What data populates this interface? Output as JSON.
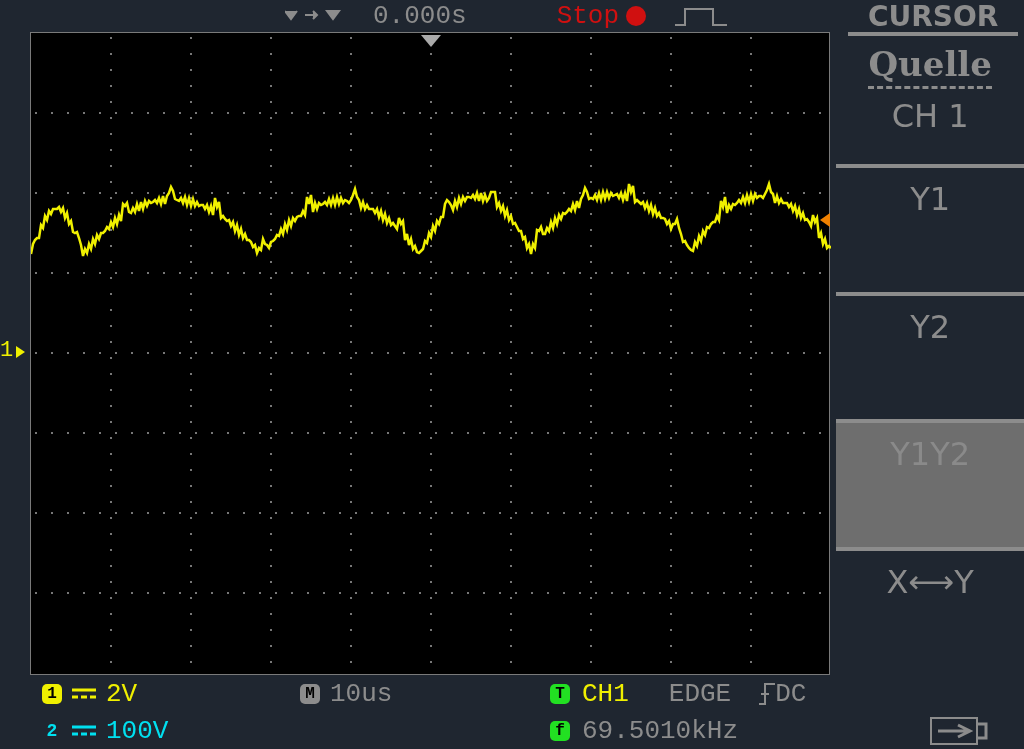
{
  "top_bar": {
    "trigger_position": "0.000s",
    "run_state": "Stop"
  },
  "display": {
    "channel_marker": "1"
  },
  "menu": {
    "title": "CURSOR",
    "items": [
      {
        "kind": "source",
        "label": "Quelle",
        "value": "CH 1",
        "selected": false
      },
      {
        "kind": "option",
        "label": "Y1",
        "selected": false
      },
      {
        "kind": "option",
        "label": "Y2",
        "selected": false
      },
      {
        "kind": "option",
        "label": "Y1Y2",
        "selected": true
      },
      {
        "kind": "option",
        "label": "X⟷Y",
        "selected": false
      }
    ]
  },
  "status": {
    "ch1": {
      "badge": "1",
      "scale": "2V"
    },
    "ch2": {
      "badge": "2",
      "scale": "100V"
    },
    "timebase": {
      "badge": "M",
      "value": "10us"
    },
    "trigger": {
      "badge": "T",
      "source": "CH1",
      "type": "EDGE",
      "coupling": "DC"
    },
    "frequency": {
      "badge": "f",
      "value": "69.5010kHz"
    }
  }
}
